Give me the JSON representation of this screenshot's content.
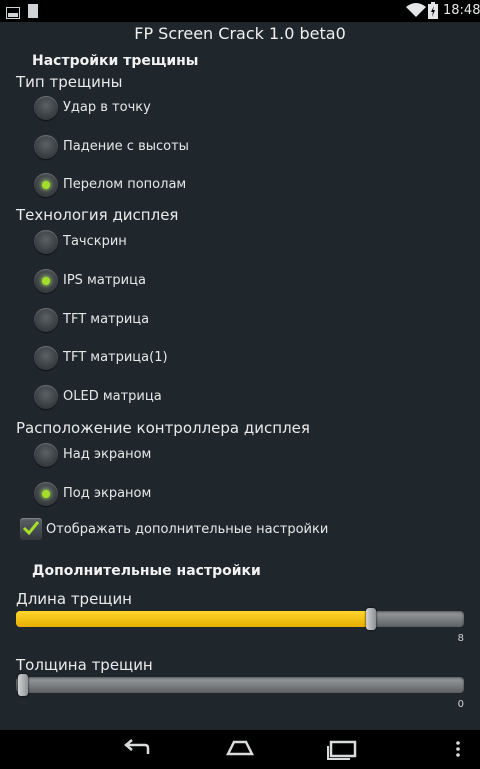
{
  "status_bar": {
    "time": "18:48",
    "left_icons": [
      "image-notification-icon",
      "sd-card-icon"
    ],
    "right_icons": [
      "wifi-icon",
      "battery-icon"
    ]
  },
  "app": {
    "title": "FP Screen Crack  1.0 beta0"
  },
  "settings": {
    "title": "Настройки трещины",
    "crack_type": {
      "label": "Тип трещины",
      "options": [
        "Удар в точку",
        "Падение с высоты",
        "Перелом пополам"
      ],
      "selected": "Перелом пополам"
    },
    "display_tech": {
      "label": "Технология дисплея",
      "options": [
        "Тачскрин",
        "IPS матрица",
        "TFT матрица",
        "TFT матрица(1)",
        "OLED матрица"
      ],
      "selected": "IPS матрица"
    },
    "controller_position": {
      "label": "Расположение контроллера дисплея",
      "options": [
        "Над экраном",
        "Под экраном"
      ],
      "selected": "Под экраном"
    },
    "show_extra": {
      "label": "Отображать дополнительные настройки",
      "checked": true
    }
  },
  "extra": {
    "title": "Дополнительные настройки",
    "crack_length": {
      "label": "Длина трещин",
      "value": "8",
      "fill_percent": 79
    },
    "crack_thickness": {
      "label": "Толщина трещин",
      "value": "0",
      "fill_percent": 0
    }
  },
  "navbar": {
    "icons": [
      "back-icon",
      "home-icon",
      "recents-icon",
      "overflow-menu-icon"
    ]
  },
  "colors": {
    "accent": "#a3de2a",
    "slider_fill": "#ffd000",
    "background": "#1f272d"
  }
}
